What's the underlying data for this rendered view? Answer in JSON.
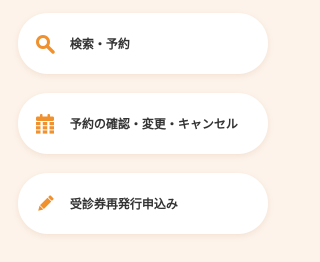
{
  "theme": {
    "accent": "#f0912e",
    "background": "#fdf3ea",
    "card": "#ffffff",
    "text": "#333333"
  },
  "menu": {
    "items": [
      {
        "icon": "search-icon",
        "label": "検索・予約"
      },
      {
        "icon": "calendar-icon",
        "label": "予約の確認・変更・キャンセル"
      },
      {
        "icon": "pencil-icon",
        "label": "受診券再発行申込み"
      }
    ]
  }
}
